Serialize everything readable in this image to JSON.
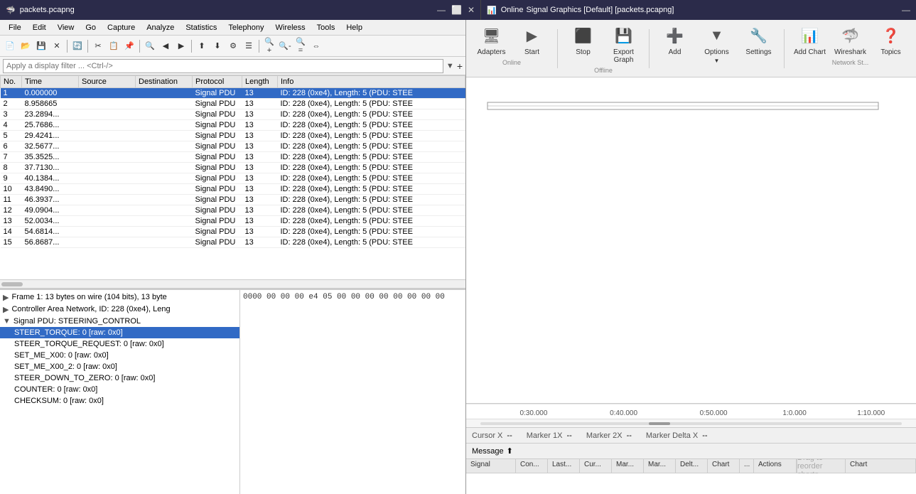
{
  "wireshark": {
    "title": "packets.pcapng",
    "signal_title": "Signal Graphics [Default] [packets.pcapng]",
    "menu": [
      "File",
      "Edit",
      "View",
      "Go",
      "Capture",
      "Analyze",
      "Statistics",
      "Telephony",
      "Wireless",
      "Tools",
      "Help"
    ],
    "filter_placeholder": "Apply a display filter ... <Ctrl-/>",
    "columns": [
      "No.",
      "Time",
      "Source",
      "Destination",
      "Protocol",
      "Length",
      "Info"
    ],
    "packets": [
      {
        "no": "1",
        "time": "0.000000",
        "src": "",
        "dst": "",
        "proto": "Signal PDU",
        "len": "13",
        "info": "ID: 228 (0xe4), Length: 5 (PDU: STEE",
        "selected": true
      },
      {
        "no": "2",
        "time": "8.958665",
        "src": "",
        "dst": "",
        "proto": "Signal PDU",
        "len": "13",
        "info": "ID: 228 (0xe4), Length: 5 (PDU: STEE"
      },
      {
        "no": "3",
        "time": "23.2894...",
        "src": "",
        "dst": "",
        "proto": "Signal PDU",
        "len": "13",
        "info": "ID: 228 (0xe4), Length: 5 (PDU: STEE"
      },
      {
        "no": "4",
        "time": "25.7686...",
        "src": "",
        "dst": "",
        "proto": "Signal PDU",
        "len": "13",
        "info": "ID: 228 (0xe4), Length: 5 (PDU: STEE"
      },
      {
        "no": "5",
        "time": "29.4241...",
        "src": "",
        "dst": "",
        "proto": "Signal PDU",
        "len": "13",
        "info": "ID: 228 (0xe4), Length: 5 (PDU: STEE"
      },
      {
        "no": "6",
        "time": "32.5677...",
        "src": "",
        "dst": "",
        "proto": "Signal PDU",
        "len": "13",
        "info": "ID: 228 (0xe4), Length: 5 (PDU: STEE"
      },
      {
        "no": "7",
        "time": "35.3525...",
        "src": "",
        "dst": "",
        "proto": "Signal PDU",
        "len": "13",
        "info": "ID: 228 (0xe4), Length: 5 (PDU: STEE"
      },
      {
        "no": "8",
        "time": "37.7130...",
        "src": "",
        "dst": "",
        "proto": "Signal PDU",
        "len": "13",
        "info": "ID: 228 (0xe4), Length: 5 (PDU: STEE"
      },
      {
        "no": "9",
        "time": "40.1384...",
        "src": "",
        "dst": "",
        "proto": "Signal PDU",
        "len": "13",
        "info": "ID: 228 (0xe4), Length: 5 (PDU: STEE"
      },
      {
        "no": "10",
        "time": "43.8490...",
        "src": "",
        "dst": "",
        "proto": "Signal PDU",
        "len": "13",
        "info": "ID: 228 (0xe4), Length: 5 (PDU: STEE"
      },
      {
        "no": "11",
        "time": "46.3937...",
        "src": "",
        "dst": "",
        "proto": "Signal PDU",
        "len": "13",
        "info": "ID: 228 (0xe4), Length: 5 (PDU: STEE"
      },
      {
        "no": "12",
        "time": "49.0904...",
        "src": "",
        "dst": "",
        "proto": "Signal PDU",
        "len": "13",
        "info": "ID: 228 (0xe4), Length: 5 (PDU: STEE"
      },
      {
        "no": "13",
        "time": "52.0034...",
        "src": "",
        "dst": "",
        "proto": "Signal PDU",
        "len": "13",
        "info": "ID: 228 (0xe4), Length: 5 (PDU: STEE"
      },
      {
        "no": "14",
        "time": "54.6814...",
        "src": "",
        "dst": "",
        "proto": "Signal PDU",
        "len": "13",
        "info": "ID: 228 (0xe4), Length: 5 (PDU: STEE"
      },
      {
        "no": "15",
        "time": "56.8687...",
        "src": "",
        "dst": "",
        "proto": "Signal PDU",
        "len": "13",
        "info": "ID: 228 (0xe4), Length: 5 (PDU: STEE"
      }
    ],
    "detail_items": [
      {
        "text": "Frame 1: 13 bytes on wire (104 bits), 13 byte",
        "expandable": true,
        "level": 0
      },
      {
        "text": "Controller Area Network, ID: 228 (0xe4), Leng",
        "expandable": true,
        "level": 0
      },
      {
        "text": "Signal PDU: STEERING_CONTROL",
        "expandable": true,
        "level": 0,
        "expanded": true
      },
      {
        "text": "STEER_TORQUE: 0 [raw: 0x0]",
        "level": 1,
        "selected": true
      },
      {
        "text": "STEER_TORQUE_REQUEST: 0 [raw: 0x0]",
        "level": 1
      },
      {
        "text": "SET_ME_X00: 0 [raw: 0x0]",
        "level": 1
      },
      {
        "text": "SET_ME_X00_2: 0 [raw: 0x0]",
        "level": 1
      },
      {
        "text": "STEER_DOWN_TO_ZERO: 0 [raw: 0x0]",
        "level": 1
      },
      {
        "text": "COUNTER: 0 [raw: 0x0]",
        "level": 1
      },
      {
        "text": "CHECKSUM: 0 [raw: 0x0]",
        "level": 1
      }
    ],
    "hex_data": "0000  00 00 00 e4 05 00 00 00  00 00 00 00 00"
  },
  "signal_graphics": {
    "toolbar_items": [
      {
        "id": "adapters",
        "label": "Adapters",
        "sublabel": "",
        "icon": "🖥",
        "section": "Online"
      },
      {
        "id": "start",
        "label": "Start",
        "sublabel": "",
        "icon": "▶",
        "section": "Online"
      },
      {
        "id": "stop",
        "label": "Stop",
        "sublabel": "",
        "icon": "⬛",
        "section": "Offline"
      },
      {
        "id": "export_graph",
        "label": "Export",
        "sublabel": "Graph",
        "icon": "💾",
        "section": "Offline"
      },
      {
        "id": "add",
        "label": "Add",
        "sublabel": "",
        "icon": "➕",
        "section": ""
      },
      {
        "id": "options",
        "label": "Options",
        "sublabel": "",
        "icon": "⚙",
        "section": ""
      },
      {
        "id": "settings",
        "label": "Settings",
        "sublabel": "",
        "icon": "🔧",
        "section": ""
      },
      {
        "id": "add_chart",
        "label": "Add Chart",
        "sublabel": "",
        "icon": "📊",
        "section": "Network St..."
      },
      {
        "id": "wireshark",
        "label": "Wireshark",
        "sublabel": "",
        "icon": "🦈",
        "section": ""
      },
      {
        "id": "topics",
        "label": "Topics",
        "sublabel": "",
        "icon": "❓",
        "section": ""
      }
    ],
    "section_labels": {
      "online": "Online",
      "offline": "Offline",
      "network": "Network St..."
    },
    "timeline": {
      "ticks": [
        "0:30.000",
        "0:40.000",
        "0:50.000",
        "1:0.000",
        "1:10.000"
      ]
    },
    "cursor_info": {
      "cursor_x_label": "Cursor X",
      "cursor_x_value": "--",
      "marker1x_label": "Marker 1X",
      "marker1x_value": "--",
      "marker2x_label": "Marker 2X",
      "marker2x_value": "--",
      "marker_delta_label": "Marker Delta X",
      "marker_delta_value": "--"
    },
    "message_label": "Message",
    "table_columns": [
      "Signal",
      "Con...",
      "Last...",
      "Cur...",
      "Mar...",
      "Mar...",
      "Delt...",
      "Chart",
      "...",
      "Actions"
    ],
    "drag_reorder": "Drag to reorder charts",
    "chart_column_header": "Chart"
  }
}
